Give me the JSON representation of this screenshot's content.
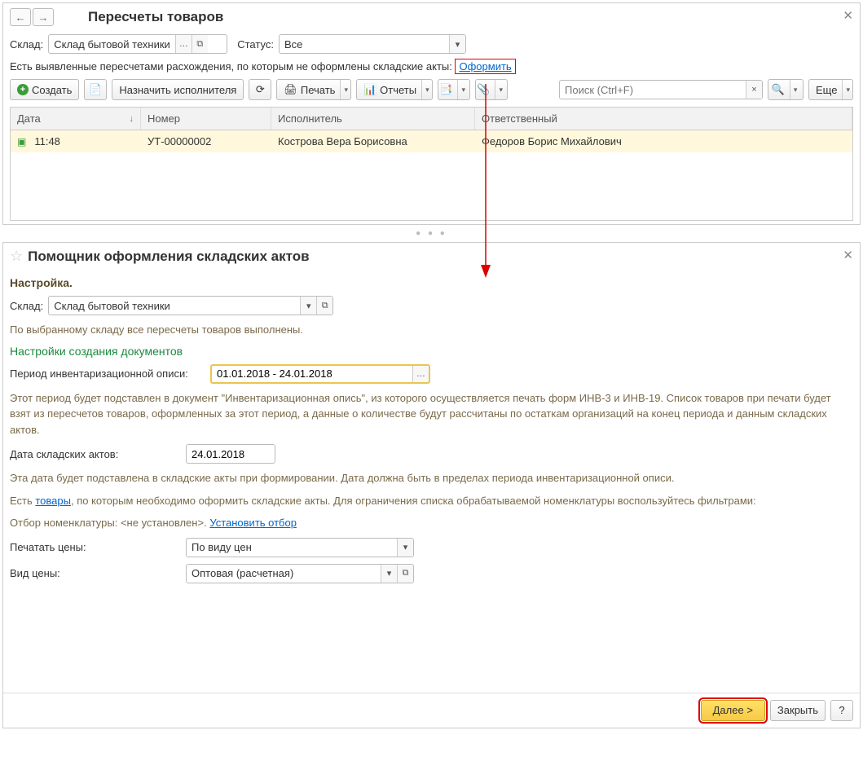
{
  "top": {
    "title": "Пересчеты товаров",
    "warehouse_label": "Склад:",
    "warehouse_value": "Склад бытовой техники",
    "status_label": "Статус:",
    "status_value": "Все",
    "info_text": "Есть выявленные пересчетами расхождения, по которым не оформлены складские акты:",
    "info_link": "Оформить",
    "toolbar": {
      "create": "Создать",
      "assign": "Назначить исполнителя",
      "print": "Печать",
      "reports": "Отчеты",
      "more": "Еще"
    },
    "search_placeholder": "Поиск (Ctrl+F)",
    "columns": {
      "date": "Дата",
      "number": "Номер",
      "executor": "Исполнитель",
      "responsible": "Ответственный"
    },
    "row": {
      "time": "11:48",
      "number": "УТ-00000002",
      "executor": "Кострова Вера Борисовна",
      "responsible": "Федоров Борис Михайлович"
    }
  },
  "bottom": {
    "title": "Помощник оформления складских актов",
    "setup_heading": "Настройка.",
    "warehouse_label": "Склад:",
    "warehouse_value": "Склад бытовой техники",
    "warehouse_status": "По выбранному складу все пересчеты товаров выполнены.",
    "doc_settings_heading": "Настройки создания документов",
    "period_label": "Период инвентаризационной описи:",
    "period_value": "01.01.2018 - 24.01.2018",
    "period_hint": "Этот период будет подставлен в документ \"Инвентаризационная опись\", из которого осуществляется печать форм ИНВ-3 и ИНВ-19. Список товаров при печати будет взят из пересчетов товаров, оформленных за этот период, а данные о количестве будут рассчитаны по остаткам организаций на конец периода и данным складских актов.",
    "acts_date_label": "Дата складских актов:",
    "acts_date_value": "24.01.2018",
    "acts_date_hint": "Эта дата будет подставлена в складские акты при формировании. Дата должна быть в пределах периода инвентаризационной описи.",
    "goods_text_pre": "Есть ",
    "goods_link": "товары",
    "goods_text_post": ", по которым необходимо оформить складские акты. Для ограничения списка обрабатываемой номенклатуры воспользуйтесь фильтрами:",
    "filter_label": "Отбор номенклатуры: <не установлен>.",
    "filter_link": "Установить отбор",
    "print_prices_label": "Печатать цены:",
    "print_prices_value": "По виду цен",
    "price_type_label": "Вид цены:",
    "price_type_value": "Оптовая (расчетная)",
    "next_btn": "Далее >",
    "close_btn": "Закрыть"
  }
}
